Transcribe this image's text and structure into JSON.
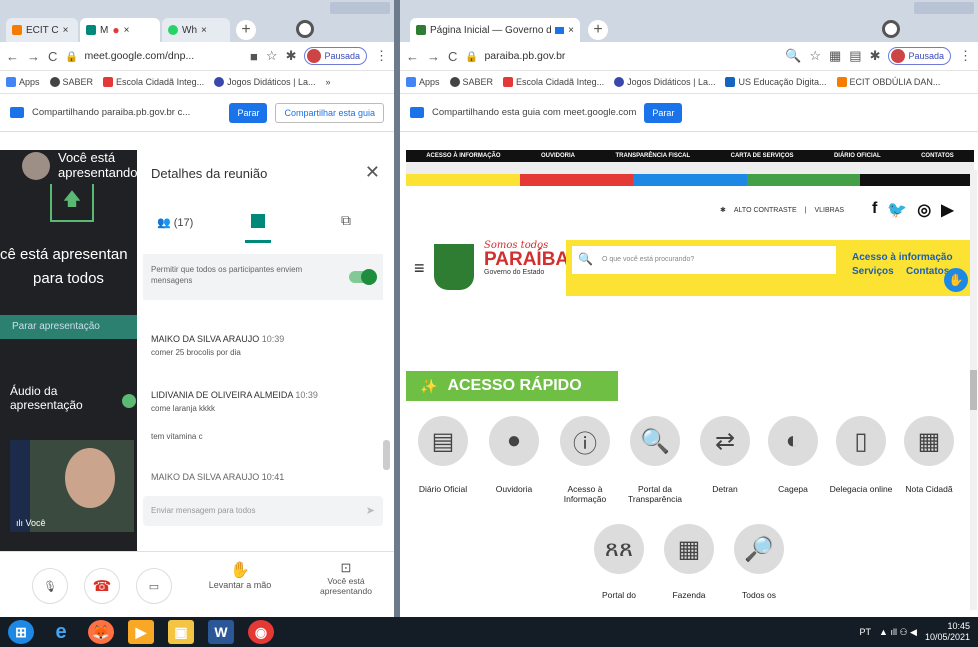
{
  "left_browser": {
    "tabs": [
      "ECIT C",
      "M",
      "Wh"
    ],
    "url": "meet.google.com/dnp...",
    "profile_label": "Pausada",
    "bookmarks": [
      "Apps",
      "SABER",
      "Escola Cidadã Integ...",
      "Jogos Didáticos | La..."
    ],
    "bookmarks_more": "»",
    "share_text": "Compartilhando paraiba.pb.gov.br c...",
    "stop_label": "Parar",
    "share_this_tab_label": "Compartilhar esta guia"
  },
  "meet": {
    "presenting_header": "Você está apresentando",
    "presenting_big": "cê está apresentan",
    "presenting_big2": "para todos",
    "stop_presenting": "Parar apresentação",
    "audio_label": "Áudio da apresentação",
    "self_label": "Você",
    "panel_title": "Detalhes da reunião",
    "participants_count": "(17)",
    "allow_messages": "Permitir que todos os participantes enviem mensagens",
    "messages": [
      {
        "name": "MAIKO DA SILVA ARAUJO",
        "time": "10:39",
        "text": "comer 25 brocolis por dia"
      },
      {
        "name": "LIDIVANIA DE OLIVEIRA ALMEIDA",
        "time": "10:39",
        "text": "come laranja kkkk"
      },
      {
        "name": "",
        "time": "",
        "text": "tem vitamina c"
      },
      {
        "name": "MAIKO DA SILVA ARAUJO",
        "time": "10:41",
        "text": ""
      }
    ],
    "input_placeholder": "Enviar mensagem para todos",
    "raise_hand": "Levantar a mão",
    "you_presenting": "Você está apresentando"
  },
  "right_browser": {
    "tab_title": "Página Inicial — Governo do",
    "url": "paraiba.pb.gov.br",
    "profile_label": "Pausada",
    "bookmarks": [
      "Apps",
      "SABER",
      "Escola Cidadã Integ...",
      "Jogos Didáticos | La...",
      "US Educação Digita...",
      "ECIT OBDÚLIA DAN..."
    ],
    "share_text": "Compartilhando esta guia com meet.google.com",
    "stop_label": "Parar"
  },
  "site": {
    "nav": [
      "ACESSO À INFORMAÇÃO",
      "OUVIDORIA",
      "TRANSPARÊNCIA FISCAL",
      "CARTA DE SERVIÇOS",
      "DIÁRIO OFICIAL",
      "CONTATOS"
    ],
    "contrast": "ALTO CONTRASTE",
    "libras": "VLIBRAS",
    "logo_small": "Somos todos",
    "logo_big": "PARAÍBA",
    "logo_sub": "Governo do Estado",
    "search_placeholder": "O que você está procurando?",
    "right_links": [
      "Acesso à informação",
      "Serviços",
      "Contatos"
    ],
    "quick_title": "ACESSO RÁPIDO",
    "quick_items": [
      "Diário Oficial",
      "Ouvidoria",
      "Acesso à Informação",
      "Portal da Transparência",
      "Detran",
      "Cagepa",
      "Delegacia online",
      "Nota Cidadã",
      "Portal do",
      "Fazenda",
      "Todos os"
    ]
  },
  "taskbar": {
    "lang": "PT",
    "time": "10:45",
    "date": "10/05/2021"
  },
  "colors": {
    "meet_green": "#5bb974",
    "google_blue": "#1a73e8",
    "paraiba_yellow": "#fbe233",
    "paraiba_green": "#6fbf44",
    "taskbar": "#141d26"
  }
}
